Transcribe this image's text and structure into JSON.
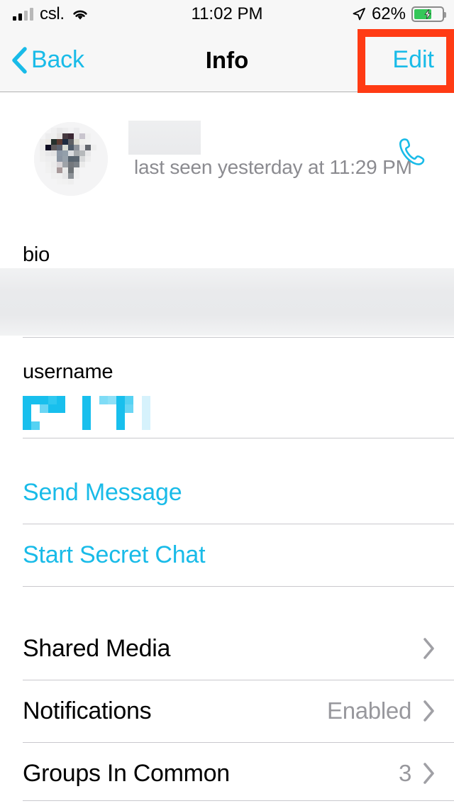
{
  "status_bar": {
    "carrier": "csl.",
    "wifi_icon": "wifi-icon",
    "time": "11:02 PM",
    "location_icon": "location-arrow-icon",
    "battery_percent": "62%",
    "battery_icon": "battery-charging-icon",
    "signal_icon": "cellular-signal-icon"
  },
  "nav_bar": {
    "back_label": "Back",
    "back_icon": "chevron-left-icon",
    "title": "Info",
    "edit_label": "Edit"
  },
  "profile": {
    "avatar_icon": "avatar-pixelated",
    "name": "",
    "last_seen": "last seen yesterday at 11:29 PM",
    "call_icon": "phone-icon"
  },
  "fields": {
    "bio_label": "bio",
    "bio_value": "",
    "username_label": "username",
    "username_value": ""
  },
  "actions": [
    {
      "label": "Send Message",
      "name": "send-message"
    },
    {
      "label": "Start Secret Chat",
      "name": "start-secret-chat"
    }
  ],
  "menu": [
    {
      "label": "Shared Media",
      "value": "",
      "name": "shared-media"
    },
    {
      "label": "Notifications",
      "value": "Enabled",
      "name": "notifications"
    },
    {
      "label": "Groups In Common",
      "value": "3",
      "name": "groups-in-common"
    }
  ],
  "colors": {
    "accent": "#19bbe8",
    "annotation": "#ff3b14",
    "secondary_text": "#8b8b90",
    "separator": "#c9c8cd",
    "navbar_bg": "#f7f7f7",
    "battery_green": "#34c759"
  },
  "annotation": {
    "target": "edit-button",
    "shape": "rectangle-highlight"
  }
}
